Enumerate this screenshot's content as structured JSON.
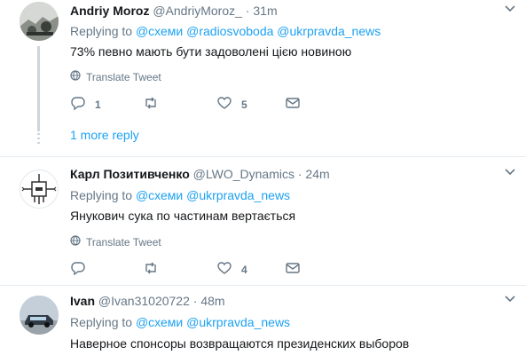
{
  "tweets": [
    {
      "name": "Andriy Moroz",
      "handle": "@AndriyMoroz_",
      "time": "31m",
      "replying_prefix": "Replying to",
      "mentions": [
        "@схеми",
        "@radiosvoboda",
        "@ukrpravda_news"
      ],
      "text": "73% певно мають бути задоволені цією новиною",
      "translate": "Translate Tweet",
      "reply_count": "1",
      "retweet_count": "",
      "like_count": "5",
      "more_replies": "1 more reply"
    },
    {
      "name": "Карл Позитивченко",
      "handle": "@LWO_Dynamics",
      "time": "24m",
      "replying_prefix": "Replying to",
      "mentions": [
        "@схеми",
        "@ukrpravda_news"
      ],
      "text": "Янукович сука по частинам вертається",
      "translate": "Translate Tweet",
      "reply_count": "",
      "retweet_count": "",
      "like_count": "4"
    },
    {
      "name": "Ivan",
      "handle": "@Ivan31020722",
      "time": "48m",
      "replying_prefix": "Replying to",
      "mentions": [
        "@схеми",
        "@ukrpravda_news"
      ],
      "text": "Наверное спонсоры возвращаются президенских выборов"
    }
  ],
  "separator": "·",
  "colors": {
    "accent": "#1da1f2",
    "muted": "#657786",
    "text": "#14171a",
    "border": "#e6ecf0"
  },
  "icons": [
    "caret-down-icon",
    "globe-icon",
    "reply-icon",
    "retweet-icon",
    "heart-icon",
    "mail-icon"
  ]
}
